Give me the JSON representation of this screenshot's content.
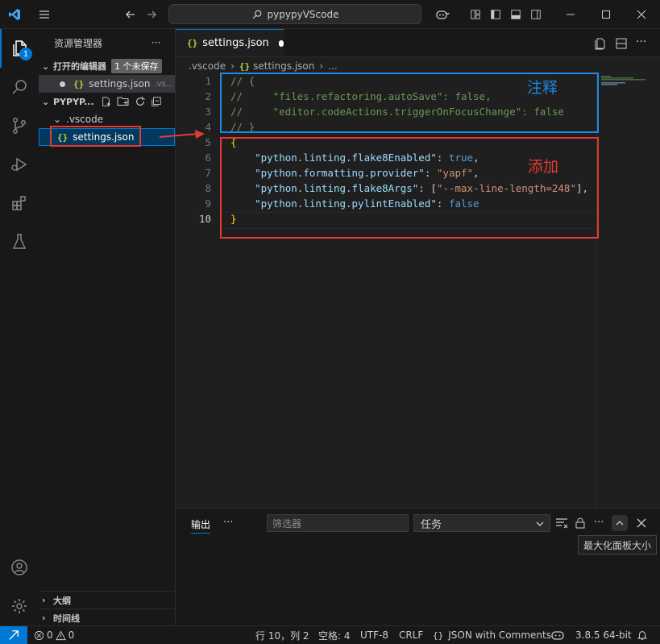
{
  "titlebar": {
    "search_text": "pypypyVScode"
  },
  "sidebar": {
    "title": "资源管理器",
    "open_editors_label": "打开的编辑器",
    "unsaved_badge": "1 个未保存",
    "open_file_name": "settings.json",
    "open_file_path": ".vs...",
    "workspace_label": "PYPYP...",
    "folder_name": ".vscode",
    "selected_file": "settings.json",
    "outline_label": "大纲",
    "timeline_label": "时间线"
  },
  "activity": {
    "explorer_badge": "1"
  },
  "editor": {
    "tab_label": "settings.json",
    "breadcrumb": [
      ".vscode",
      "settings.json",
      "..."
    ],
    "line_numbers": [
      "1",
      "2",
      "3",
      "4",
      "5",
      "6",
      "7",
      "8",
      "9",
      "10"
    ],
    "lines": [
      [
        {
          "t": "// {",
          "c": "cmt"
        }
      ],
      [
        {
          "t": "//     \"files.refactoring.autoSave\": false,",
          "c": "cmt"
        }
      ],
      [
        {
          "t": "//     \"editor.codeActions.triggerOnFocusChange\": false",
          "c": "cmt"
        }
      ],
      [
        {
          "t": "// }",
          "c": "cmt"
        }
      ],
      [
        {
          "t": "{",
          "c": "brace"
        }
      ],
      [
        {
          "t": "    ",
          "c": "pun"
        },
        {
          "t": "\"python.linting.flake8Enabled\"",
          "c": "key"
        },
        {
          "t": ": ",
          "c": "pun"
        },
        {
          "t": "true",
          "c": "kw"
        },
        {
          "t": ",",
          "c": "pun"
        }
      ],
      [
        {
          "t": "    ",
          "c": "pun"
        },
        {
          "t": "\"python.formatting.provider\"",
          "c": "key"
        },
        {
          "t": ": ",
          "c": "pun"
        },
        {
          "t": "\"yapf\"",
          "c": "str"
        },
        {
          "t": ",",
          "c": "pun"
        }
      ],
      [
        {
          "t": "    ",
          "c": "pun"
        },
        {
          "t": "\"python.linting.flake8Args\"",
          "c": "key"
        },
        {
          "t": ": [",
          "c": "pun"
        },
        {
          "t": "\"--max-line-length=248\"",
          "c": "str"
        },
        {
          "t": "],",
          "c": "pun"
        }
      ],
      [
        {
          "t": "    ",
          "c": "pun"
        },
        {
          "t": "\"python.linting.pylintEnabled\"",
          "c": "key"
        },
        {
          "t": ": ",
          "c": "pun"
        },
        {
          "t": "false",
          "c": "kw"
        }
      ],
      [
        {
          "t": "}",
          "c": "brace"
        }
      ]
    ]
  },
  "annotations": {
    "comment_label": "注释",
    "add_label": "添加",
    "comment_color": "#1e88e5",
    "add_color": "#e53935"
  },
  "panel": {
    "output_tab": "输出",
    "filter_placeholder": "筛选器",
    "task_select": "任务",
    "tooltip": "最大化面板大小"
  },
  "statusbar": {
    "errors": "0",
    "warnings": "0",
    "position": "行 10，列 2",
    "spaces": "空格: 4",
    "encoding": "UTF-8",
    "eol": "CRLF",
    "language": "JSON with Comments",
    "python_version": "3.8.5 64-bit"
  }
}
